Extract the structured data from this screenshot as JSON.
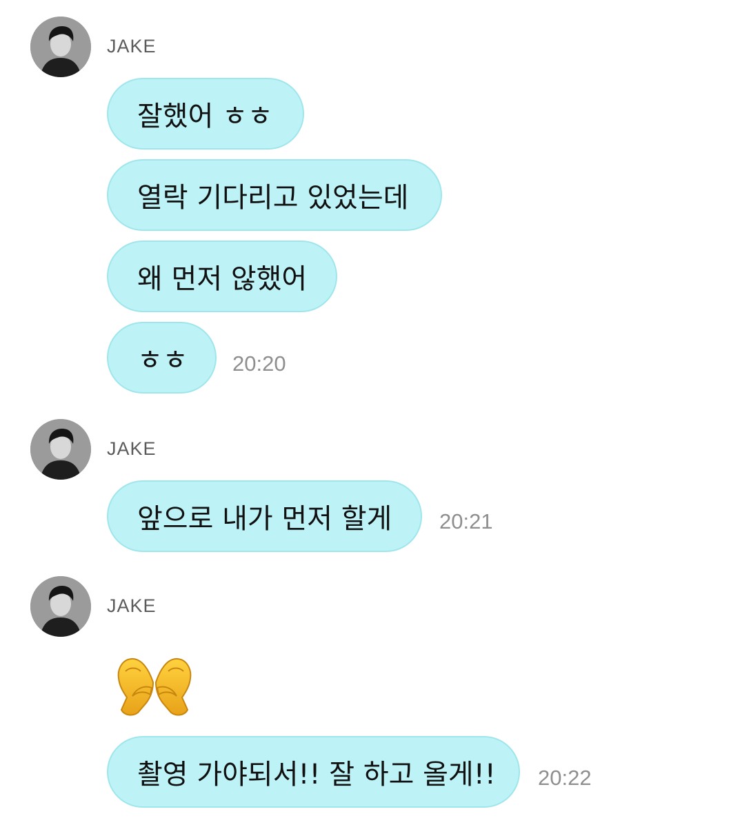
{
  "groups": [
    {
      "sender": "JAKE",
      "messages": [
        "잘했어 ㅎㅎ",
        "열락 기다리고 있었는데",
        "왜 먼저 않했어",
        "ㅎㅎ"
      ],
      "time": "20:20"
    },
    {
      "sender": "JAKE",
      "messages": [
        "앞으로 내가 먼저 할게"
      ],
      "time": "20:21"
    },
    {
      "sender": "JAKE",
      "emoji": "heart-hands-emoji",
      "messages": [
        "촬영 가야되서!! 잘 하고 올게!!"
      ],
      "time": "20:22"
    }
  ],
  "colors": {
    "bubble_fill": "#bdf2f6",
    "bubble_border": "#9fe6ec",
    "timestamp": "#8e8e8e",
    "sender_name": "#5b5b5b",
    "emoji_yellow": "#f7b829"
  }
}
